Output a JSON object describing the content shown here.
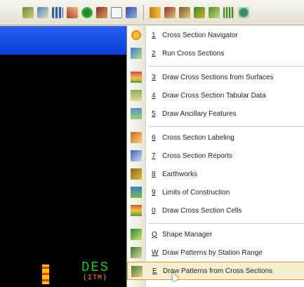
{
  "toolbar": {
    "icons": [
      "wave-icon",
      "pencil-icon",
      "grid-icon",
      "arrow-icon",
      "tree-icon",
      "brush-icon",
      "document-icon",
      "cube-icon",
      "book-icon",
      "text-icon",
      "stamp-icon",
      "stairs-icon",
      "graph-icon",
      "chart-icon",
      "gear-icon"
    ]
  },
  "viewport": {
    "text": "DES",
    "subtext": "(ITM)"
  },
  "menu": {
    "items": [
      {
        "key": "1",
        "label": "Cross Section Navigator",
        "icon": "navigator-icon"
      },
      {
        "key": "2",
        "label": "Run Cross Sections",
        "icon": "run-icon"
      },
      {
        "key": "3",
        "label": "Draw Cross Sections from Surfaces",
        "icon": "surface-icon"
      },
      {
        "key": "4",
        "label": "Draw Cross Section Tabular Data",
        "icon": "tabular-icon"
      },
      {
        "key": "5",
        "label": "Draw Ancillary Features",
        "icon": "ancillary-icon"
      },
      {
        "key": "6",
        "label": "Cross Section Labeling",
        "icon": "labeling-icon"
      },
      {
        "key": "7",
        "label": "Cross Section Reports",
        "icon": "reports-icon"
      },
      {
        "key": "8",
        "label": "Earthworks",
        "icon": "earthworks-icon"
      },
      {
        "key": "9",
        "label": "Limits of Construction",
        "icon": "limits-icon"
      },
      {
        "key": "0",
        "label": "Draw Cross Section Cells",
        "icon": "cells-icon"
      },
      {
        "key": "Q",
        "label": "Shape Manager",
        "icon": "shape-icon"
      },
      {
        "key": "W",
        "label": "Draw Patterns by Station Range",
        "icon": "patterns-range-icon"
      },
      {
        "key": "E",
        "label": "Draw Patterns from Cross Sections",
        "icon": "patterns-xs-icon"
      }
    ]
  }
}
